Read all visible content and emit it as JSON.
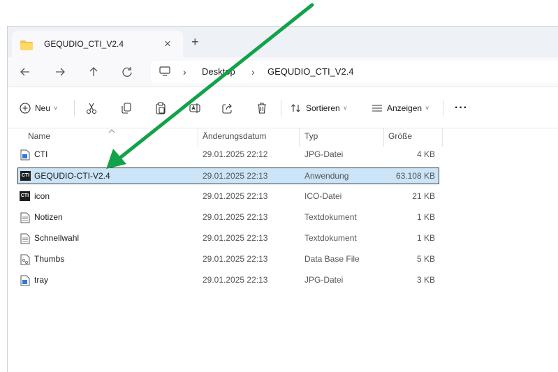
{
  "tab": {
    "title": "GEQUDIO_CTI_V2.4",
    "close": "×",
    "new": "+"
  },
  "address": {
    "crumbs": [
      "Desktop",
      "GEQUDIO_CTI_V2.4"
    ],
    "sep": "›"
  },
  "toolbar": {
    "new_label": "Neu",
    "sort_label": "Sortieren",
    "view_label": "Anzeigen",
    "more": "···",
    "chev": "˅"
  },
  "columns": [
    "Name",
    "Änderungsdatum",
    "Typ",
    "Größe"
  ],
  "files": [
    {
      "name": "CTI",
      "date": "29.01.2025 22:12",
      "type": "JPG-Datei",
      "size": "4 KB",
      "icon": "jpg-file-icon"
    },
    {
      "name": "GEQUDIO-CTI-V2.4",
      "date": "29.01.2025 22:13",
      "type": "Anwendung",
      "size": "63.108 KB",
      "icon": "cti-app-icon",
      "selected": true
    },
    {
      "name": "icon",
      "date": "29.01.2025 22:13",
      "type": "ICO-Datei",
      "size": "21 KB",
      "icon": "cti-ico-icon"
    },
    {
      "name": "Notizen",
      "date": "29.01.2025 22:13",
      "type": "Textdokument",
      "size": "1 KB",
      "icon": "text-file-icon"
    },
    {
      "name": "Schnellwahl",
      "date": "29.01.2025 22:13",
      "type": "Textdokument",
      "size": "1 KB",
      "icon": "text-file-icon"
    },
    {
      "name": "Thumbs",
      "date": "29.01.2025 22:13",
      "type": "Data Base File",
      "size": "5 KB",
      "icon": "db-file-icon"
    },
    {
      "name": "tray",
      "date": "29.01.2025 22:13",
      "type": "JPG-Datei",
      "size": "3 KB",
      "icon": "jpg-file-icon"
    }
  ],
  "ctibadge": "CTI",
  "colors": {
    "accent": "#0067c0",
    "selection": "#cce4f7",
    "annotation_arrow": "#12a24a"
  }
}
